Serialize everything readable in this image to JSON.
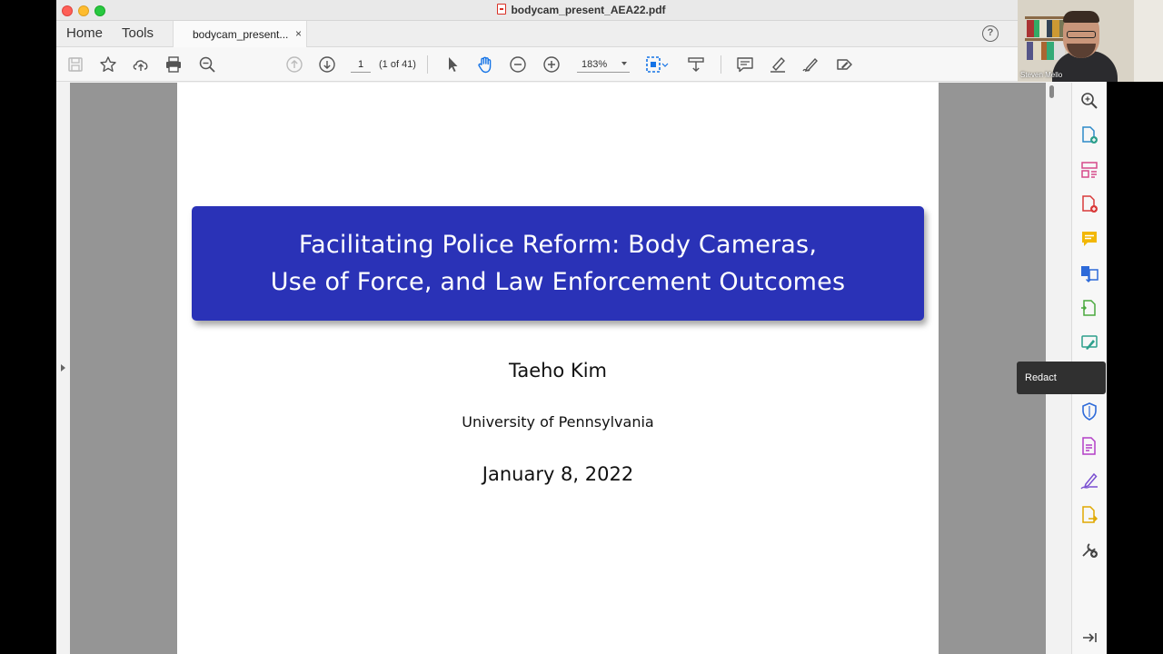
{
  "window": {
    "title": "bodycam_present_AEA22.pdf"
  },
  "tabs": {
    "home": "Home",
    "tools": "Tools",
    "document": "bodycam_present...",
    "close": "×",
    "help": "?"
  },
  "toolbar": {
    "page_current": "1",
    "page_total": "(1 of 41)",
    "zoom": "183%",
    "icons": [
      "save-icon",
      "bookmark-star-icon",
      "upload-cloud-icon",
      "print-icon",
      "zoom-out-search-icon",
      "previous-page-icon",
      "next-page-icon",
      "select-arrow-icon",
      "hand-tool-icon",
      "zoom-out-icon",
      "zoom-in-icon",
      "fit-page-icon",
      "scroll-mode-icon",
      "comment-icon",
      "highlight-icon",
      "sign-icon",
      "edit-tag-icon"
    ]
  },
  "slide": {
    "title_line1": "Facilitating Police Reform: Body Cameras,",
    "title_line2": "Use of Force, and Law Enforcement Outcomes",
    "author": "Taeho Kim",
    "institution": "University of Pennsylvania",
    "date": "January 8, 2022"
  },
  "right_panel": {
    "tooltip": "Redact",
    "icons": [
      "search-zoom-icon",
      "create-pdf-icon",
      "organize-pages-icon",
      "export-pdf-icon",
      "comment-icon",
      "combine-files-icon",
      "compress-icon",
      "edit-pdf-icon",
      "redact-icon",
      "protect-icon",
      "fill-form-icon",
      "sign-icon",
      "send-for-review-icon",
      "more-tools-icon",
      "collapse-panel-icon"
    ]
  },
  "webcam": {
    "name": "Steven Mello"
  },
  "colors": {
    "title_box": "#2a32b7",
    "accent_blue": "#1a73e8",
    "active_tool": "#1473e6"
  }
}
